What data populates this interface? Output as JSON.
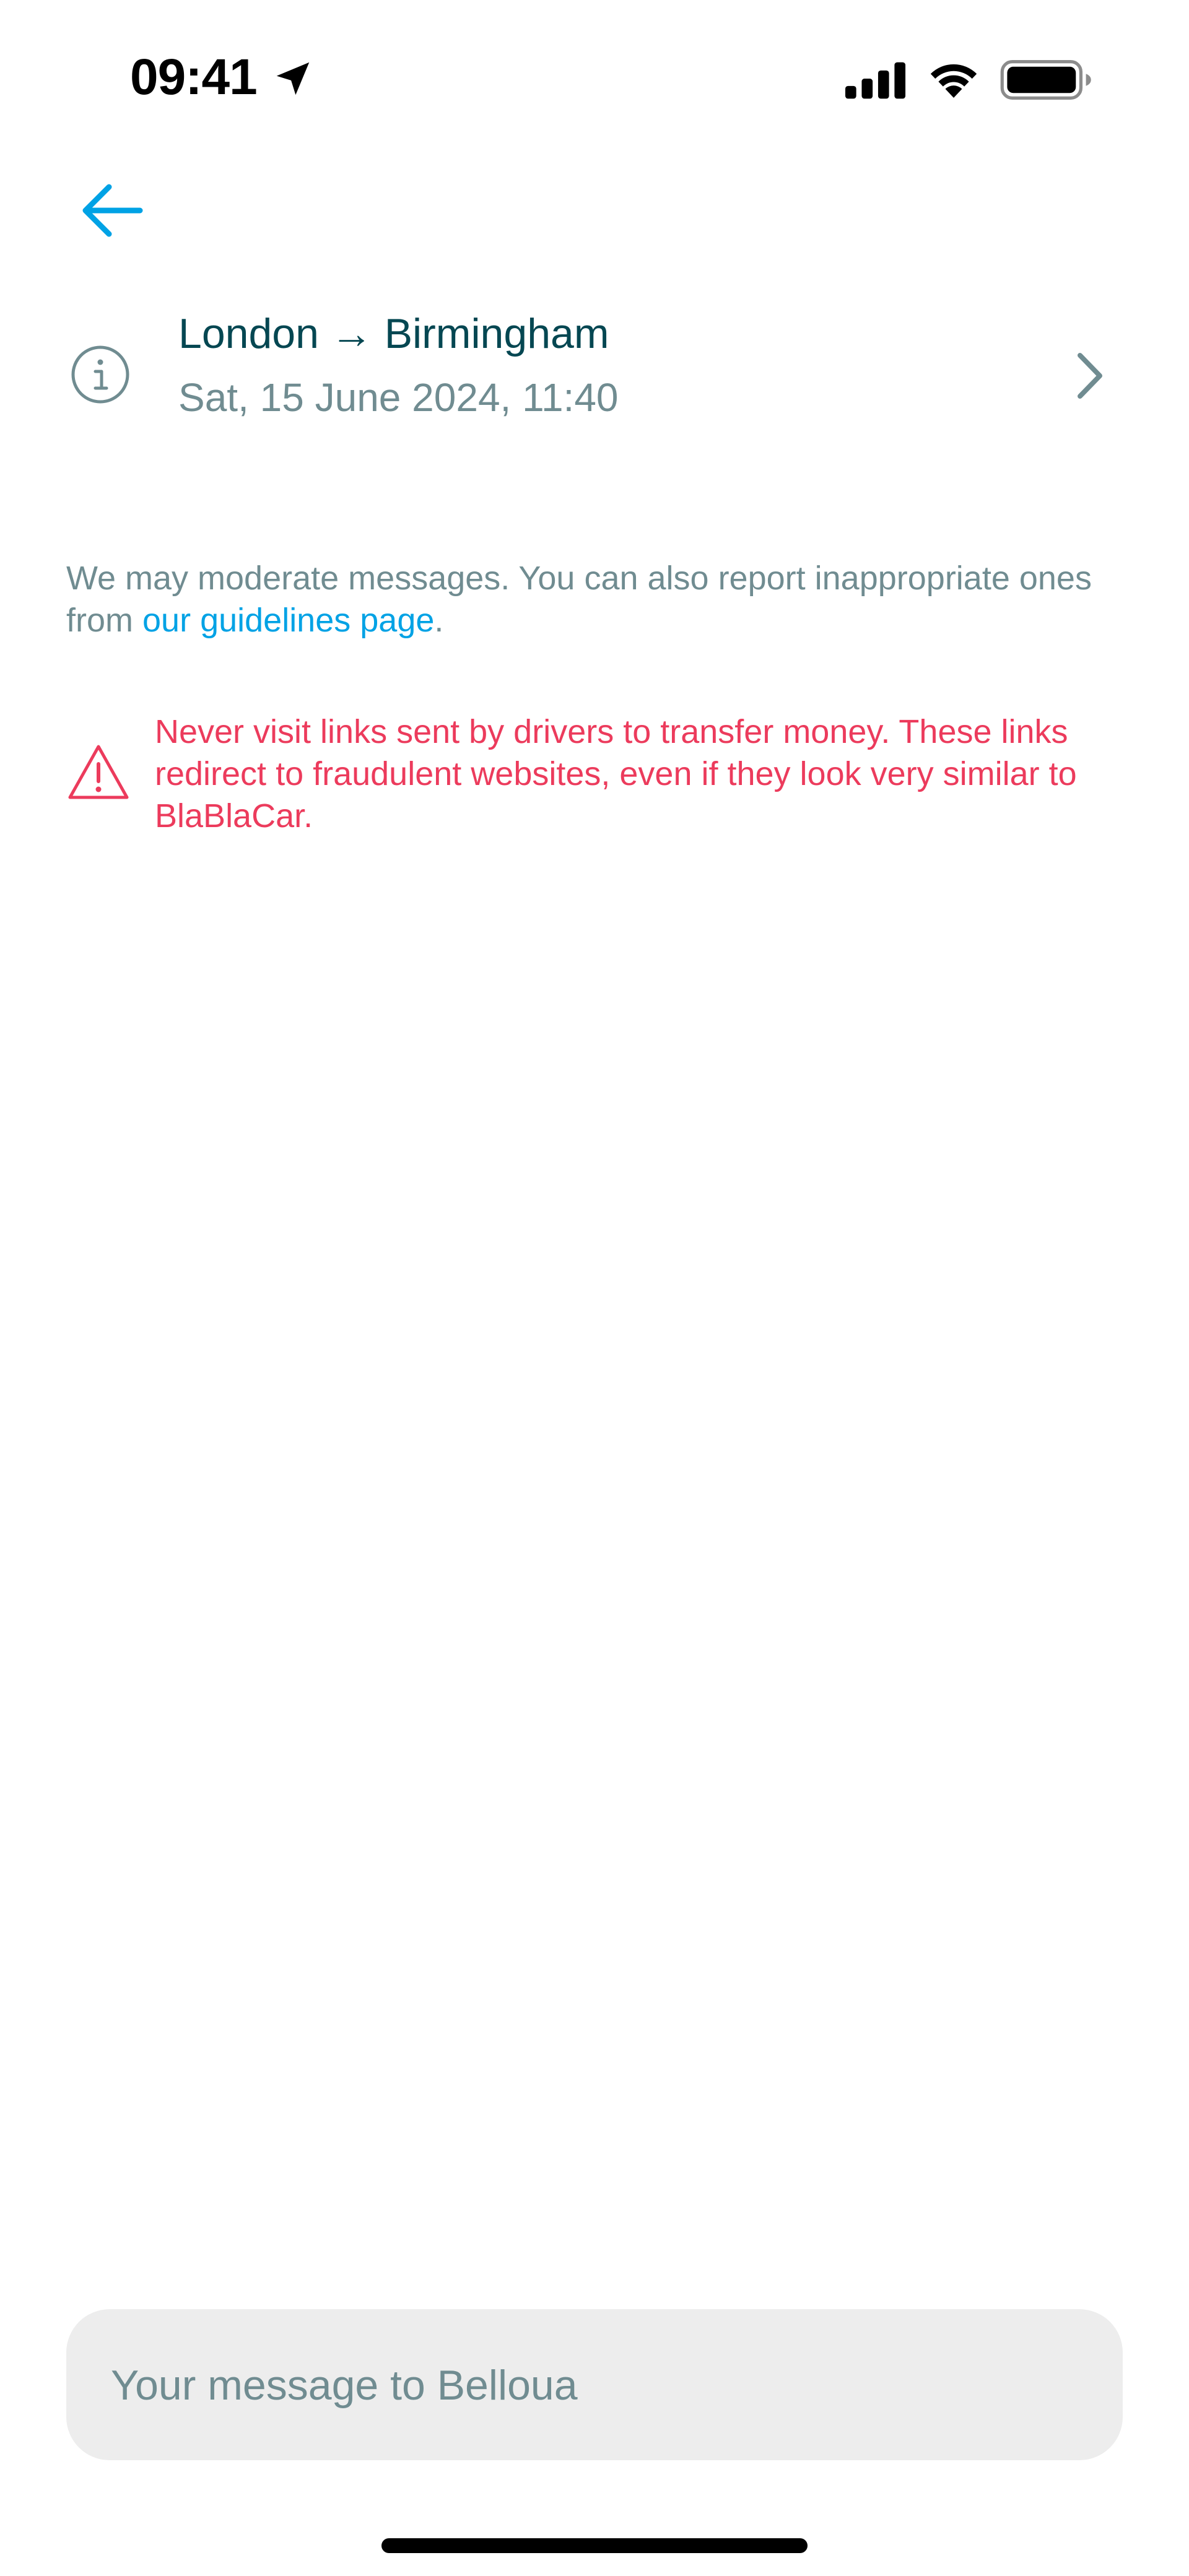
{
  "status_bar": {
    "time": "09:41",
    "icons": [
      "location-arrow-icon",
      "cellular-signal-icon",
      "wifi-icon",
      "battery-icon"
    ]
  },
  "header": {
    "back_icon": "arrow-left-icon"
  },
  "trip": {
    "route": "London → Birmingham",
    "datetime": "Sat, 15 June 2024, 11:40",
    "info_icon": "info-circle-icon",
    "chevron_icon": "chevron-right-icon"
  },
  "moderation": {
    "text_before": "We may moderate messages. You can also report inappropriate ones from ",
    "link_label": "our guidelines page",
    "text_after": "."
  },
  "warning": {
    "icon": "warning-triangle-icon",
    "text": "Never visit links sent by drivers to transfer money. These links redirect to fraudulent websites, even if they look very similar to BlaBlaCar."
  },
  "composer": {
    "placeholder": "Your message to Belloua",
    "value": ""
  },
  "colors": {
    "accent": "#00a2e5",
    "primary_text": "#054752",
    "secondary_text": "#708c91",
    "danger": "#ec3b5c",
    "input_background": "#ededed"
  }
}
